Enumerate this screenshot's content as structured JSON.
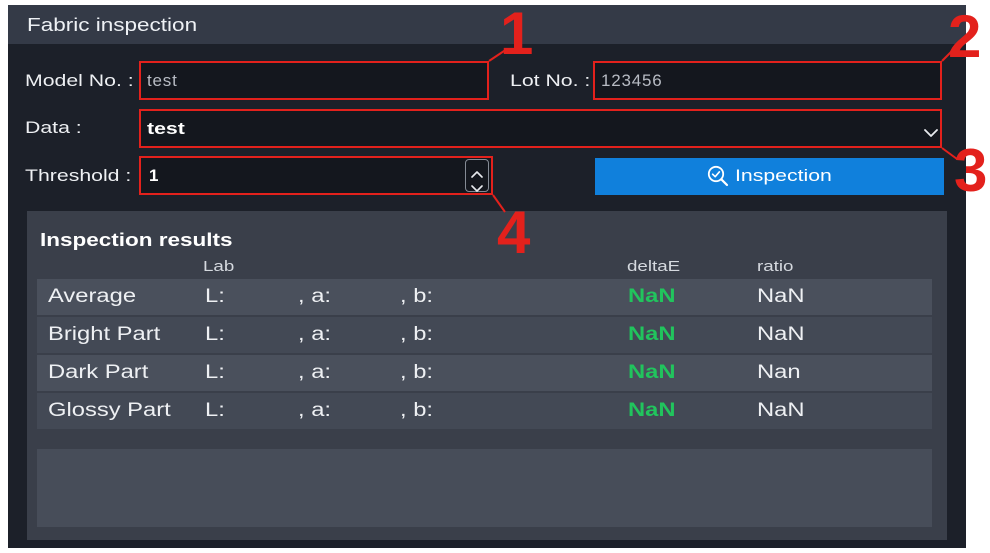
{
  "window": {
    "title": "Fabric inspection"
  },
  "form": {
    "model_no": {
      "label": "Model No. :",
      "value": "test"
    },
    "lot_no": {
      "label": "Lot No. :",
      "value": "123456"
    },
    "data": {
      "label": "Data :",
      "value": "test",
      "icon": "chevron-down-icon"
    },
    "threshold": {
      "label": "Threshold :",
      "value": "1",
      "icons": [
        "chevron-up-icon",
        "chevron-down-icon"
      ]
    },
    "inspect_button": {
      "label": "Inspection",
      "icon": "search-check-icon"
    }
  },
  "results": {
    "title": "Inspection results",
    "columns": {
      "lab": "Lab",
      "delta_e": "deltaE",
      "ratio": "ratio"
    },
    "lab_labels": {
      "l": "L:",
      "a": ", a:",
      "b": ", b:"
    },
    "rows": [
      {
        "name": "Average",
        "delta_e": "NaN",
        "ratio": "NaN"
      },
      {
        "name": "Bright Part",
        "delta_e": "NaN",
        "ratio": "NaN"
      },
      {
        "name": "Dark Part",
        "delta_e": "NaN",
        "ratio": "Nan"
      },
      {
        "name": "Glossy Part",
        "delta_e": "NaN",
        "ratio": "NaN"
      }
    ]
  },
  "annotations": [
    {
      "label": "1"
    },
    {
      "label": "2"
    },
    {
      "label": "3"
    },
    {
      "label": "4"
    }
  ],
  "colors": {
    "background": "#1c2029",
    "title_bar": "#343a47",
    "accent": "#1080dc",
    "annotation": "#e3211c",
    "delta_e_value": "#21c45d"
  }
}
